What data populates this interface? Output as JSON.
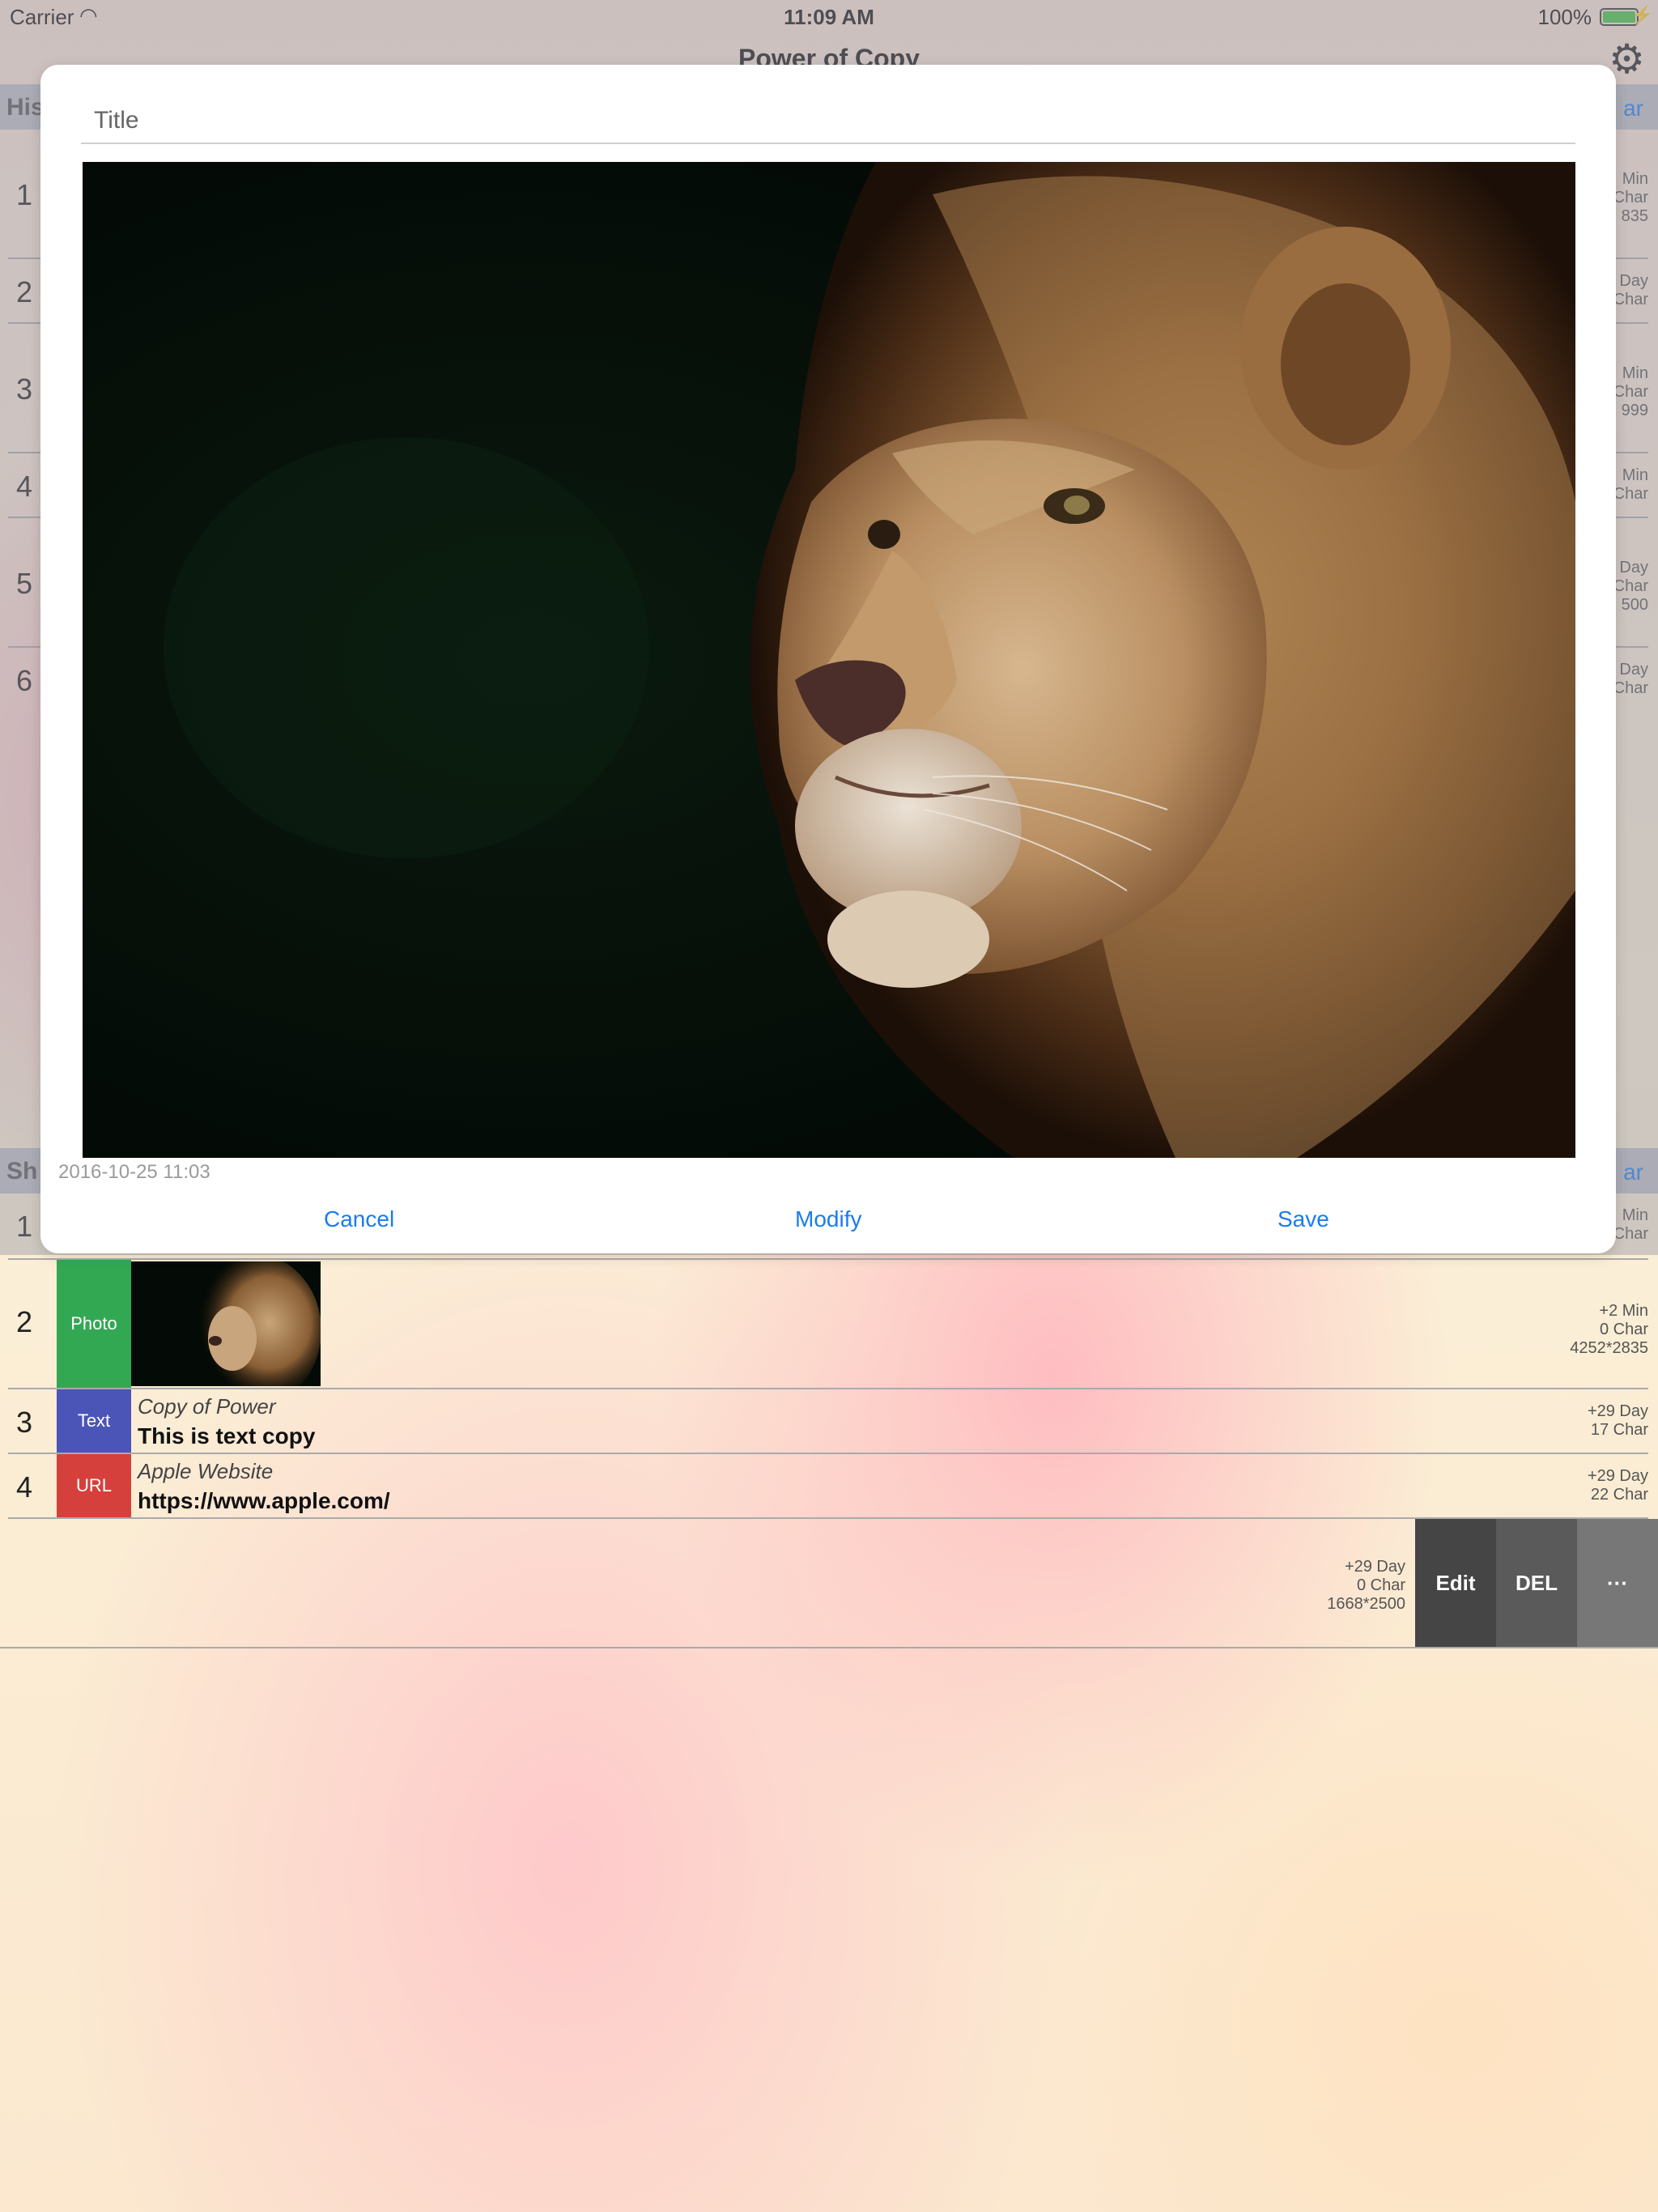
{
  "status_bar": {
    "carrier": "Carrier",
    "time": "11:09 AM",
    "battery": "100%"
  },
  "nav": {
    "title": "Power of Copy"
  },
  "history": {
    "header": "His",
    "action": "ar",
    "rows": [
      {
        "num": "1",
        "meta": [
          "Min",
          "Char",
          "835"
        ]
      },
      {
        "num": "2",
        "meta": [
          "Day",
          "Char"
        ]
      },
      {
        "num": "3",
        "meta": [
          "Min",
          "Char",
          "999"
        ]
      },
      {
        "num": "4",
        "meta": [
          "Min",
          "Char"
        ]
      },
      {
        "num": "5",
        "meta": [
          "Day",
          "Char",
          "500"
        ]
      },
      {
        "num": "6",
        "meta": [
          "Day",
          "Char"
        ]
      }
    ]
  },
  "shelf": {
    "header": "Sh",
    "action": "ar",
    "rows": [
      {
        "num": "1",
        "meta": [
          "Min",
          "Char"
        ]
      },
      {
        "num": "2",
        "type": "Photo",
        "meta": [
          "+2 Min",
          "0 Char",
          "4252*2835"
        ]
      },
      {
        "num": "3",
        "type": "Text",
        "title": "Copy of Power",
        "body": "This is text copy",
        "meta": [
          "+29 Day",
          "17 Char"
        ]
      },
      {
        "num": "4",
        "type": "URL",
        "title": "Apple Website",
        "body": "https://www.apple.com/",
        "meta": [
          "+29 Day",
          "22 Char"
        ]
      },
      {
        "meta": [
          "+29 Day",
          "0 Char",
          "1668*2500"
        ],
        "actions": [
          "Edit",
          "DEL",
          "···"
        ]
      }
    ]
  },
  "modal": {
    "title_placeholder": "Title",
    "timestamp": "2016-10-25 11:03",
    "buttons": {
      "cancel": "Cancel",
      "modify": "Modify",
      "save": "Save"
    }
  },
  "colors": {
    "accent": "#1a7cf0",
    "photo": "#33a853",
    "text": "#4b55b8",
    "url": "#d6403c"
  },
  "icons": {
    "settings": "gear-icon",
    "wifi": "wifi-icon",
    "battery": "battery-icon"
  }
}
